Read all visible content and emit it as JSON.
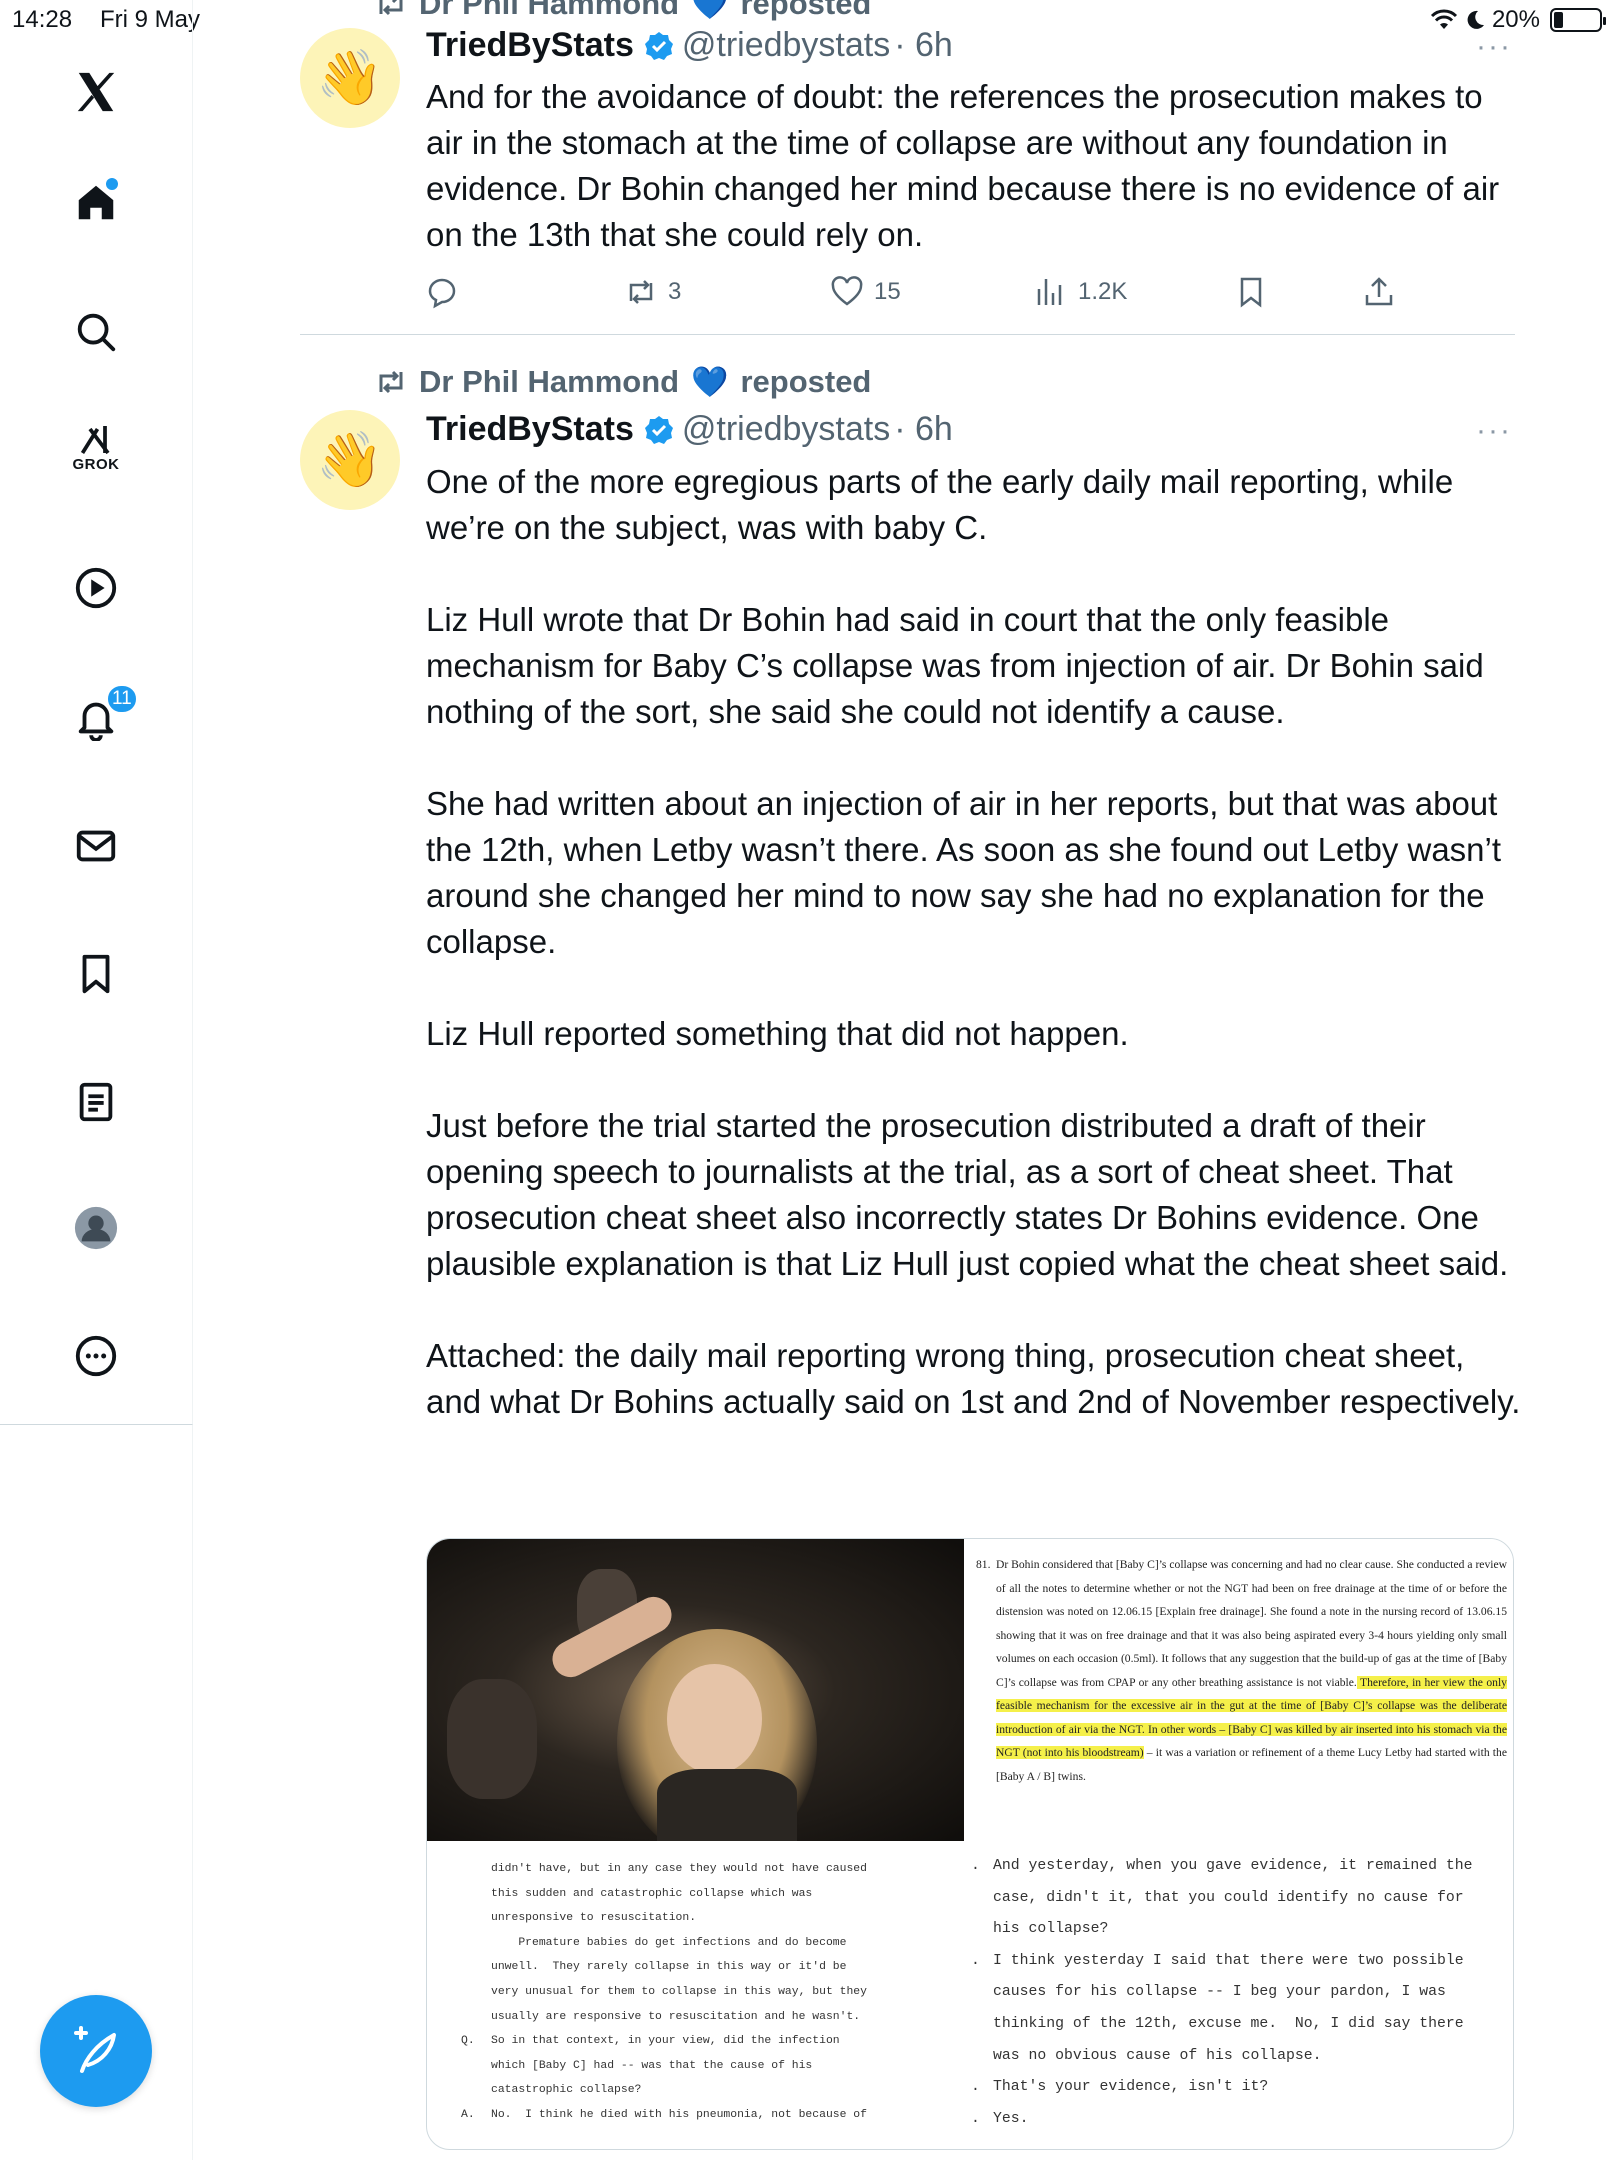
{
  "status_bar": {
    "time": "14:28",
    "date": "Fri 9 May",
    "battery": "20%",
    "battery_level": 0.2
  },
  "sidebar": {
    "items": [
      {
        "name": "home",
        "icon": "home-icon"
      },
      {
        "name": "explore",
        "icon": "search-icon"
      },
      {
        "name": "grok",
        "icon": "grok-icon",
        "label": "GROK"
      },
      {
        "name": "videos",
        "icon": "play-icon"
      },
      {
        "name": "notifications",
        "icon": "bell-icon",
        "badge": "11"
      },
      {
        "name": "messages",
        "icon": "mail-icon"
      },
      {
        "name": "bookmarks",
        "icon": "bookmark-icon"
      },
      {
        "name": "lists",
        "icon": "list-icon"
      },
      {
        "name": "profile",
        "icon": "avatar-icon"
      },
      {
        "name": "more",
        "icon": "more-icon"
      }
    ],
    "compose_icon": "compose-icon"
  },
  "tweets": [
    {
      "repost_by": "Dr Phil Hammond",
      "repost_suffix": "reposted",
      "author": "TriedByStats",
      "handle": "@triedbystats",
      "time": "· 6h",
      "more": "···",
      "text": "And for the avoidance of doubt: the references the prosecution makes to air in the stomach at the time of collapse are without any foundation in evidence. Dr Bohin changed her mind because there is no evidence of air on the 13th that she could rely on.",
      "reposts": "3",
      "likes": "15",
      "views": "1.2K"
    },
    {
      "repost_by": "Dr Phil Hammond",
      "repost_suffix": "reposted",
      "author": "TriedByStats",
      "handle": "@triedbystats",
      "time": "· 6h",
      "more": "···",
      "paragraphs": [
        "One of the more egregious parts of the early daily mail reporting, while we’re on the subject, was with baby C.",
        "Liz Hull wrote that Dr Bohin had said in court that the only feasible mechanism for Baby C’s collapse was from injection of air. Dr Bohin said nothing of the sort, she said she could not identify a cause.",
        "She had written about an injection of air in her reports, but that was about the 12th, when Letby wasn’t there. As soon as she found out Letby wasn’t around she changed her mind to now say she had no explanation for the collapse.",
        "Liz Hull reported something that did not happen.",
        "Just before the trial started the prosecution distributed a draft of their opening speech to journalists at the trial, as a sort of cheat sheet. That prosecution cheat sheet also incorrectly states Dr Bohins evidence. One plausible explanation is that Liz Hull just copied what the cheat sheet said.",
        "Attached: the daily mail reporting wrong thing, prosecution cheat sheet, and what Dr Bohins actually said on 1st and 2nd of November respectively."
      ],
      "attachment": {
        "report_number": "81.",
        "report_plain": "Dr Bohin considered that [Baby C]’s collapse was concerning and had no clear cause. She conducted a review of all the notes to determine whether or not the NGT had been on free drainage at the time of or before the distension was noted on 12.06.15 [Explain free drainage]. She found a note in the nursing record of 13.06.15 showing that it was on free drainage and that it was also being aspirated every 3-4 hours yielding only small volumes on each occasion (0.5ml). It follows that any suggestion that the build-up of gas at the time of [Baby C]’s collapse was from CPAP or any other breathing assistance is not viable.",
        "report_highlight": " Therefore, in her view the only feasible mechanism for the excessive air in the gut at the time of [Baby C]’s collapse was the deliberate introduction of air via the NGT. In other words – [Baby C] was killed by air inserted into his stomach via the NGT (not into his bloodstream)",
        "report_tail": " – it was a variation or refinement of a theme Lucy Letby had started with the [Baby A / B] twins.",
        "transcript_left": [
          {
            "m": "",
            "t": "didn't have, but in any case they would not have caused"
          },
          {
            "m": "",
            "t": "this sudden and catastrophic collapse which was"
          },
          {
            "m": "",
            "t": "unresponsive to resuscitation."
          },
          {
            "m": "",
            "t": "    Premature babies do get infections and do become"
          },
          {
            "m": "",
            "t": "unwell.  They rarely collapse in this way or it'd be"
          },
          {
            "m": "",
            "t": "very unusual for them to collapse in this way, but they"
          },
          {
            "m": "",
            "t": "usually are responsive to resuscitation and he wasn't."
          },
          {
            "m": "Q.",
            "t": "So in that context, in your view, did the infection"
          },
          {
            "m": "",
            "t": "which [Baby C] had -- was that the cause of his"
          },
          {
            "m": "",
            "t": "catastrophic collapse?"
          },
          {
            "m": "A.",
            "t": "No.  I think he died with his pneumonia, not because of"
          }
        ],
        "transcript_right": [
          {
            "m": ".",
            "t": "And yesterday, when you gave evidence, it remained the"
          },
          {
            "m": "",
            "t": "case, didn't it, that you could identify no cause for"
          },
          {
            "m": "",
            "t": "his collapse?"
          },
          {
            "m": ".",
            "t": "I think yesterday I said that there were two possible"
          },
          {
            "m": "",
            "t": "causes for his collapse -- I beg your pardon, I was"
          },
          {
            "m": "",
            "t": "thinking of the 12th, excuse me.  No, I did say there"
          },
          {
            "m": "",
            "t": "was no obvious cause of his collapse."
          },
          {
            "m": ".",
            "t": "That's your evidence, isn't it?"
          },
          {
            "m": ".",
            "t": "Yes."
          }
        ]
      }
    }
  ],
  "colors": {
    "accent": "#1d9bf0",
    "text": "#0f1419",
    "muted": "#536471",
    "highlight": "#f5f04a"
  }
}
